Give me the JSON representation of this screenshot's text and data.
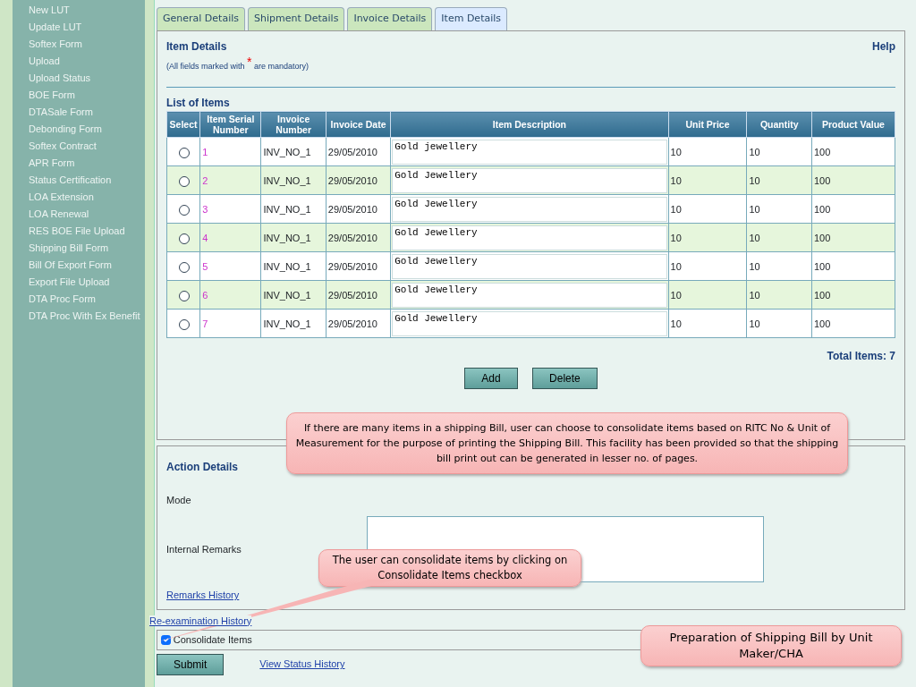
{
  "sidebar": {
    "items": [
      "New LUT",
      "Update LUT",
      "Softex Form",
      "Upload",
      "Upload Status",
      "BOE Form",
      "DTASale Form",
      "Debonding Form",
      "Softex Contract",
      "APR Form",
      "Status Certification",
      "LOA Extension",
      "LOA Renewal",
      "RES BOE File Upload",
      "Shipping Bill Form",
      "Bill Of Export Form",
      "Export File Upload",
      "DTA Proc Form",
      "DTA Proc With Ex Benefit"
    ]
  },
  "tabs": [
    {
      "label": "General Details",
      "selected": false
    },
    {
      "label": "Shipment Details",
      "selected": false
    },
    {
      "label": "Invoice Details",
      "selected": false
    },
    {
      "label": "Item Details",
      "selected": true
    }
  ],
  "item_details": {
    "title": "Item Details",
    "help": "Help",
    "note": "(All fields marked with $^{*}$ are mandatory)",
    "list_title": "List of Items",
    "columns": [
      "Select",
      "Item Serial Number",
      "Invoice Number",
      "Invoice Date",
      "Item Description",
      "Unit Price",
      "Quantity",
      "Product Value"
    ],
    "rows": [
      {
        "selected": false,
        "serial": "1",
        "invoice": "INV_NO_1",
        "date": "29/05/2010",
        "description": "Gold jewellery",
        "unit_price": "10",
        "quantity": "10",
        "product_value": "100"
      },
      {
        "selected": false,
        "serial": "2",
        "invoice": "INV_NO_1",
        "date": "29/05/2010",
        "description": "Gold Jewellery",
        "unit_price": "10",
        "quantity": "10",
        "product_value": "100"
      },
      {
        "selected": false,
        "serial": "3",
        "invoice": "INV_NO_1",
        "date": "29/05/2010",
        "description": "Gold Jewellery",
        "unit_price": "10",
        "quantity": "10",
        "product_value": "100"
      },
      {
        "selected": false,
        "serial": "4",
        "invoice": "INV_NO_1",
        "date": "29/05/2010",
        "description": "Gold Jewellery",
        "unit_price": "10",
        "quantity": "10",
        "product_value": "100"
      },
      {
        "selected": false,
        "serial": "5",
        "invoice": "INV_NO_1",
        "date": "29/05/2010",
        "description": "Gold Jewellery",
        "unit_price": "10",
        "quantity": "10",
        "product_value": "100"
      },
      {
        "selected": false,
        "serial": "6",
        "invoice": "INV_NO_1",
        "date": "29/05/2010",
        "description": "Gold Jewellery",
        "unit_price": "10",
        "quantity": "10",
        "product_value": "100"
      },
      {
        "selected": false,
        "serial": "7",
        "invoice": "INV_NO_1",
        "date": "29/05/2010",
        "description": "Gold Jewellery",
        "unit_price": "10",
        "quantity": "10",
        "product_value": "100"
      }
    ],
    "total": "Total Items: 7",
    "buttons": [
      "Add",
      "Delete"
    ]
  },
  "action_details": {
    "title": "Action Details",
    "mode_label": "Mode",
    "remarks_label": "Internal Remarks",
    "remarks_history": "Remarks History"
  },
  "reexamination_history": "Re-examination History",
  "consolidate": {
    "label": "Consolidate Items",
    "checked": true
  },
  "submit": "Submit",
  "view_status_history": "View Status History",
  "callouts": [
    {
      "kind": "top",
      "text": "If there are many items in a shipping Bill, user can choose to consolidate items based on RITC No & Unit of Measurement  for the purpose of  printing the Shipping Bill.  This facility has been provided so that the shipping bill  print out can be generated in lesser no. of pages."
    },
    {
      "kind": "pointer",
      "text": "The user  can consolidate items by clicking on Consolidate Items checkbox"
    },
    {
      "kind": "corner",
      "text": "Preparation of Shipping Bill by Unit Maker/CHA"
    }
  ]
}
